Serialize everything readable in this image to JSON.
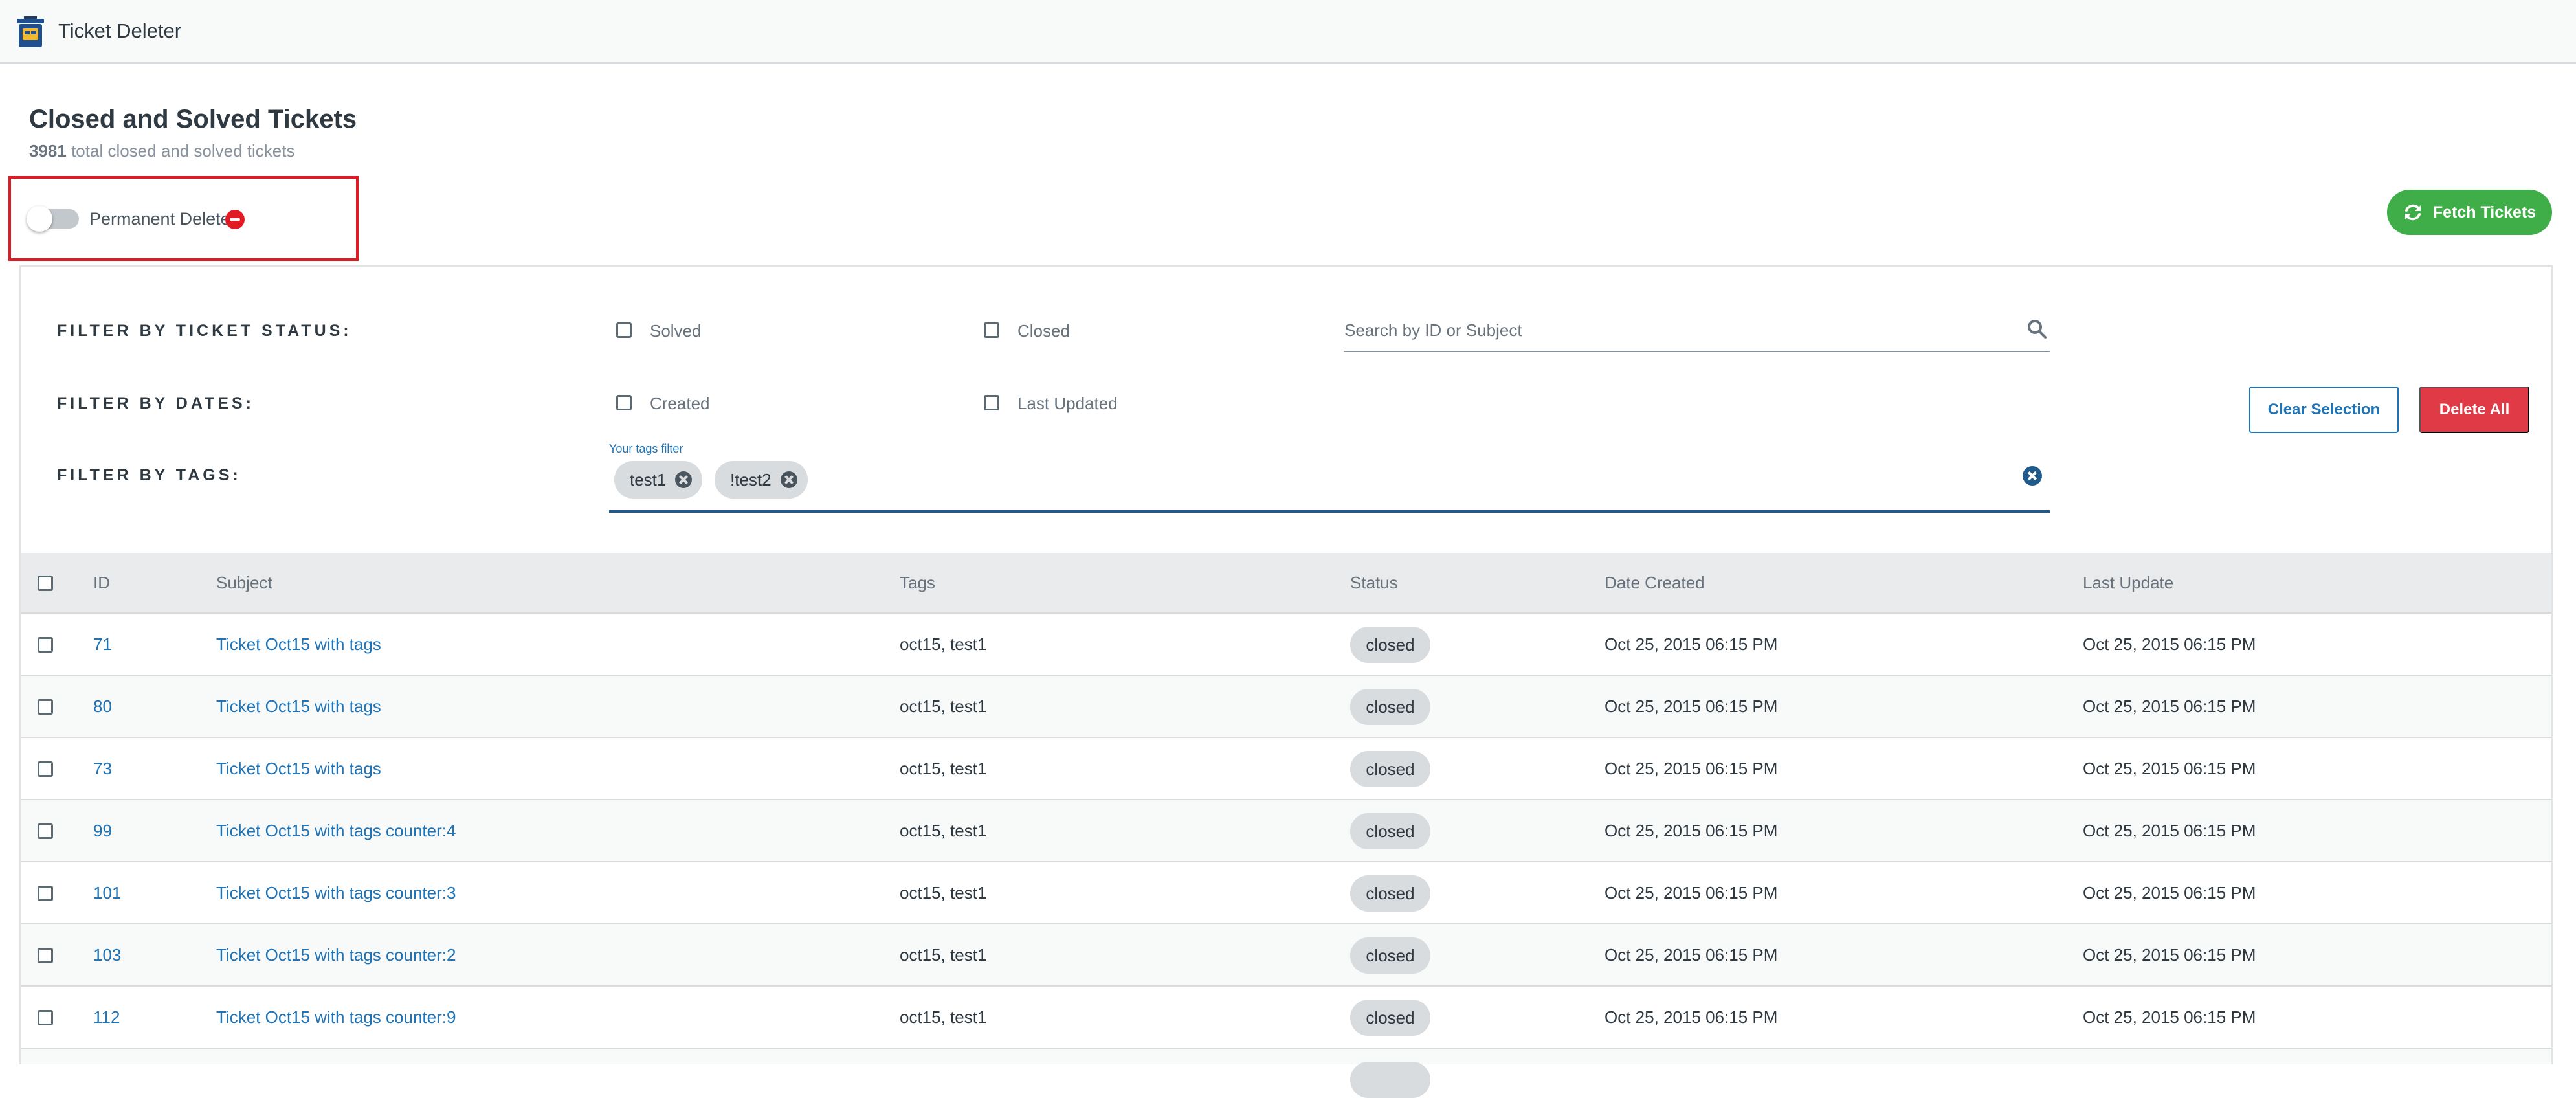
{
  "app": {
    "title": "Ticket Deleter",
    "icon": "trash-can-icon"
  },
  "page": {
    "title": "Closed and Solved Tickets",
    "total_count": "3981",
    "subtitle_suffix": "total closed and solved tickets"
  },
  "permanent_delete": {
    "label": "Permanent Delete",
    "enabled": false,
    "warning_icon": "minus-circle-icon",
    "warning_color": "#e01b24"
  },
  "actions": {
    "fetch_label": "Fetch Tickets",
    "fetch_color": "#3fae49",
    "clear_label": "Clear Selection",
    "delete_all_label": "Delete All",
    "delete_color": "#e03a47"
  },
  "filters": {
    "status": {
      "label": "FILTER BY TICKET STATUS:",
      "options": [
        "Solved",
        "Closed"
      ]
    },
    "dates": {
      "label": "FILTER BY DATES:",
      "options": [
        "Created",
        "Last Updated"
      ]
    },
    "tags": {
      "label": "FILTER BY TAGS:",
      "caption": "Your tags filter",
      "chips": [
        "test1",
        "!test2"
      ]
    },
    "search": {
      "placeholder": "Search by ID or Subject",
      "value": ""
    }
  },
  "table": {
    "columns": [
      "ID",
      "Subject",
      "Tags",
      "Status",
      "Date Created",
      "Last Update"
    ],
    "rows": [
      {
        "id": "71",
        "subject": "Ticket Oct15 with tags",
        "tags": "oct15, test1",
        "status": "closed",
        "created": "Oct 25, 2015 06:15 PM",
        "updated": "Oct 25, 2015 06:15 PM"
      },
      {
        "id": "80",
        "subject": "Ticket Oct15 with tags",
        "tags": "oct15, test1",
        "status": "closed",
        "created": "Oct 25, 2015 06:15 PM",
        "updated": "Oct 25, 2015 06:15 PM"
      },
      {
        "id": "73",
        "subject": "Ticket Oct15 with tags",
        "tags": "oct15, test1",
        "status": "closed",
        "created": "Oct 25, 2015 06:15 PM",
        "updated": "Oct 25, 2015 06:15 PM"
      },
      {
        "id": "99",
        "subject": "Ticket Oct15 with tags counter:4",
        "tags": "oct15, test1",
        "status": "closed",
        "created": "Oct 25, 2015 06:15 PM",
        "updated": "Oct 25, 2015 06:15 PM"
      },
      {
        "id": "101",
        "subject": "Ticket Oct15 with tags counter:3",
        "tags": "oct15, test1",
        "status": "closed",
        "created": "Oct 25, 2015 06:15 PM",
        "updated": "Oct 25, 2015 06:15 PM"
      },
      {
        "id": "103",
        "subject": "Ticket Oct15 with tags counter:2",
        "tags": "oct15, test1",
        "status": "closed",
        "created": "Oct 25, 2015 06:15 PM",
        "updated": "Oct 25, 2015 06:15 PM"
      },
      {
        "id": "112",
        "subject": "Ticket Oct15 with tags counter:9",
        "tags": "oct15, test1",
        "status": "closed",
        "created": "Oct 25, 2015 06:15 PM",
        "updated": "Oct 25, 2015 06:15 PM"
      }
    ]
  }
}
